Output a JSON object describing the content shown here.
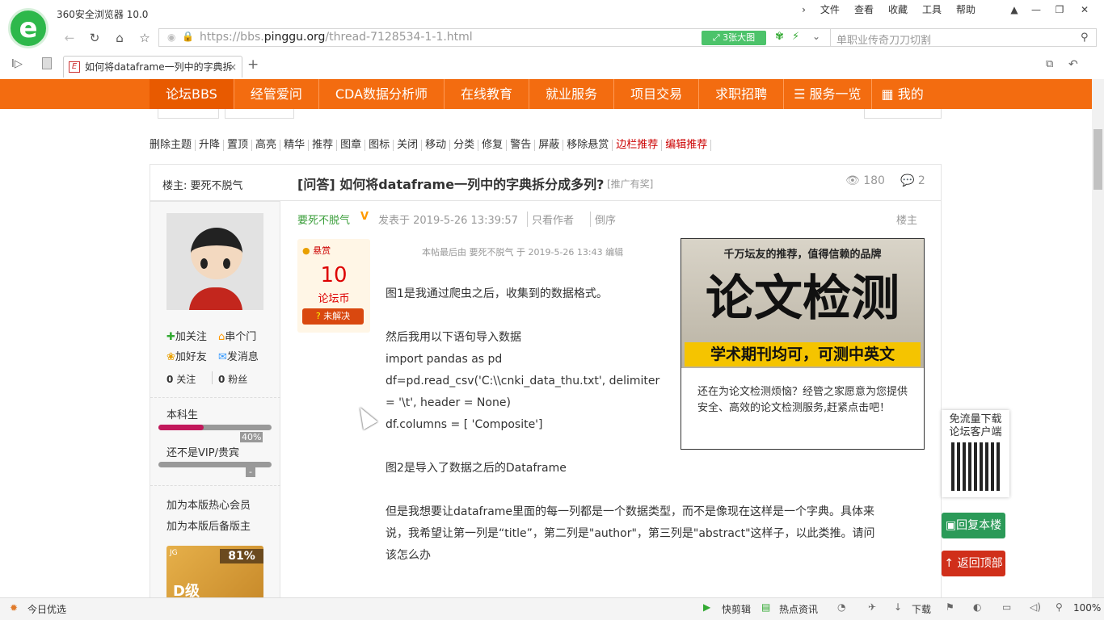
{
  "browser": {
    "name": "360安全浏览器 10.0",
    "menu": [
      "文件",
      "查看",
      "收藏",
      "工具",
      "帮助"
    ],
    "url_prefix": "https://bbs.",
    "url_domain": "pinggu.org",
    "url_suffix": "/thread-7128534-1-1.html",
    "big_image_btn": "3张大图",
    "search_placeholder": "单职业传奇刀刀切割",
    "tab_title": "如何将dataframe一列中的字典拆"
  },
  "nav": {
    "items": [
      "论坛BBS",
      "经管爱问",
      "CDA数据分析师",
      "在线教育",
      "就业服务",
      "项目交易",
      "求职招聘",
      "服务一览",
      "我的"
    ]
  },
  "moderation": {
    "actions": [
      "删除主题",
      "升降",
      "置顶",
      "高亮",
      "精华",
      "推荐",
      "图章",
      "图标",
      "关闭",
      "移动",
      "分类",
      "修复",
      "警告",
      "屏蔽",
      "移除悬赏"
    ],
    "red_actions": [
      "边栏推荐",
      "编辑推荐"
    ]
  },
  "thread": {
    "owner_label": "楼主: 要死不脱气",
    "title": "[问答] 如何将dataframe一列中的字典拆分成多列?",
    "tag": "[推广有奖]",
    "views": "180",
    "replies": "2",
    "author": "要死不脱气",
    "posted": "发表于 2019-5-26 13:39:57",
    "only_author": "只看作者",
    "reverse": "倒序",
    "floor": "楼主",
    "edit_note": "本帖最后由 要死不脱气 于 2019-5-26 13:43 编辑"
  },
  "reward": {
    "label": "悬赏",
    "amount": "10",
    "unit": "论坛币",
    "status": "未解决"
  },
  "user": {
    "follow": "加关注",
    "door": "串个门",
    "friend": "加好友",
    "message": "发消息",
    "following_count": "0",
    "following_label": "关注",
    "fans_count": "0",
    "fans_label": "粉丝",
    "level": "本科生",
    "level_progress": 0.4,
    "level_progress_text": "40%",
    "vip": "还不是VIP/贵宾",
    "vip_text": "-",
    "hot_member": "加为本版热心会员",
    "backup_mod": "加为本版后备版主",
    "badge_pct": "81%",
    "badge_grade": "D级"
  },
  "post": {
    "lines": [
      "图1是我通过爬虫之后，收集到的数据格式。",
      "然后我用以下语句导入数据",
      "import pandas as pd",
      "df=pd.read_csv('C:\\\\cnki_data_thu.txt', delimiter",
      "= '\\t', header = None)",
      "df.columns = [ 'Composite']",
      "图2是导入了数据之后的Dataframe",
      "但是我想要让dataframe里面的每一列都是一个数据类型，而不是像现在这样是一个字典。具体来",
      "说，我希望让第一列是“title”，第二列是\"author\"，第三列是\"abstract\"这样子，以此类推。请问",
      "该怎么办"
    ]
  },
  "ad": {
    "top": "千万坛友的推荐，值得信赖的品牌",
    "big": "论文检测",
    "sub": "学术期刊均可，可测中英文",
    "desc": "还在为论文检测烦恼？经管之家愿意为您提供安全、高效的论文检测服务,赶紧点击吧！"
  },
  "side": {
    "download": "免流量下载论坛客户端",
    "reply": "回复本楼",
    "top": "返回顶部"
  },
  "status": {
    "today": "今日优选",
    "clip": "快剪辑",
    "news": "热点资讯",
    "download": "下载",
    "zoom": "100%"
  }
}
